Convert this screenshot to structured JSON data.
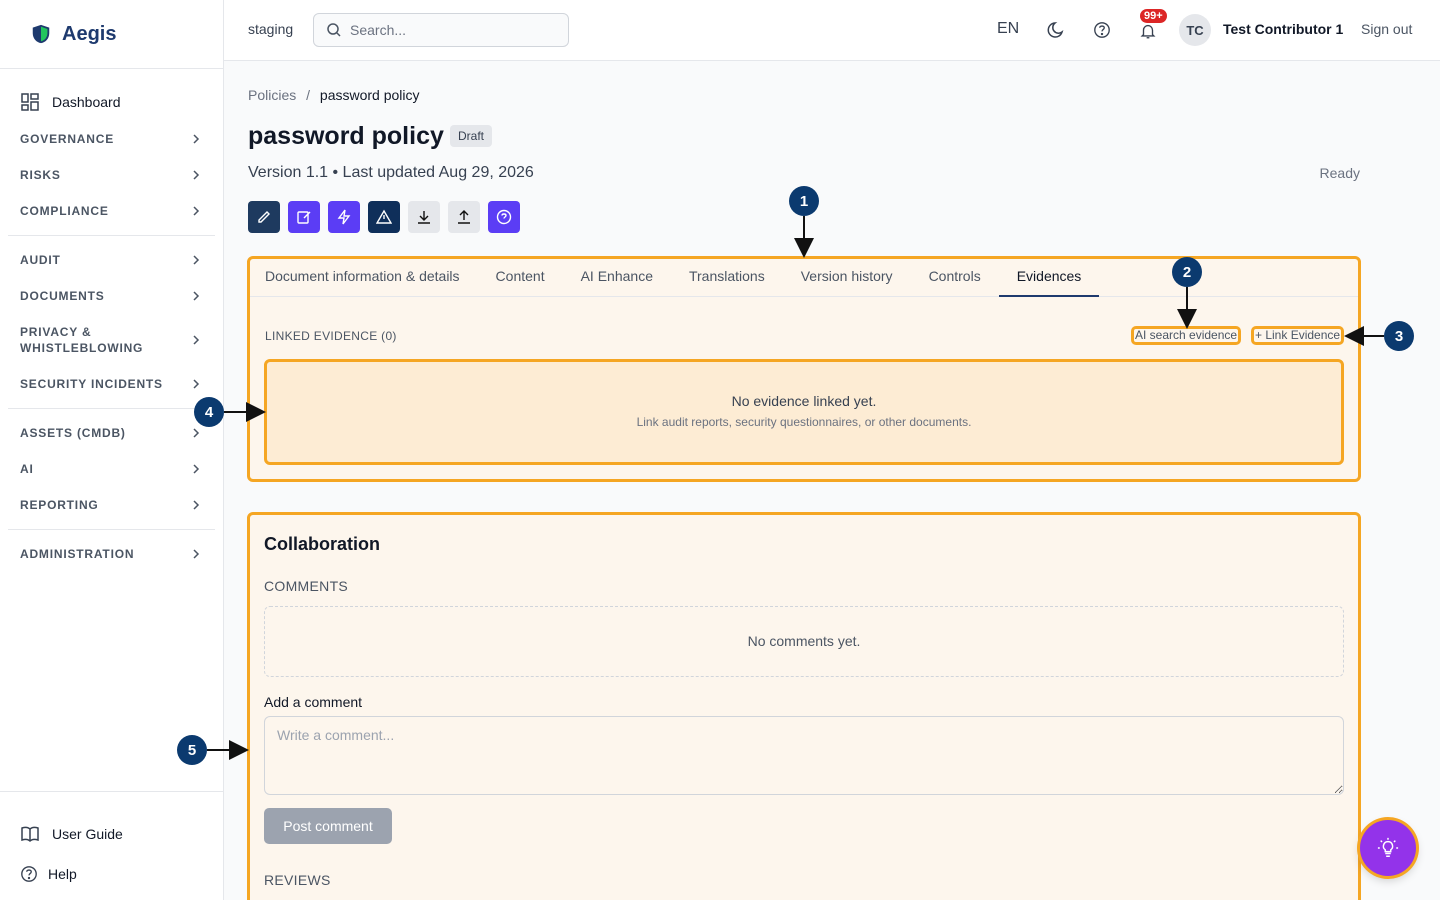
{
  "brand": {
    "name": "Aegis"
  },
  "sidebar": {
    "dashboard": "Dashboard",
    "groups": [
      [
        "Governance",
        "Risks",
        "Compliance"
      ],
      [
        "Audit",
        "Documents",
        "Privacy & Whistleblowing",
        "Security Incidents"
      ],
      [
        "Assets (CMDB)",
        "AI",
        "Reporting"
      ],
      [
        "Administration"
      ]
    ],
    "user_guide": "User Guide",
    "help": "Help"
  },
  "topbar": {
    "env": "staging",
    "search_placeholder": "Search...",
    "lang": "EN",
    "notif_count": "99+",
    "avatar": "TC",
    "user": "Test Contributor 1",
    "sign_out": "Sign out"
  },
  "page": {
    "breadcrumb_root": "Policies",
    "breadcrumb_sep": "/",
    "breadcrumb_current": "password policy",
    "title": "password policy",
    "status": "Draft",
    "meta": "Version 1.1 • Last updated Aug 29, 2026",
    "ready": "Ready"
  },
  "toolbar_icons": [
    {
      "name": "edit-icon",
      "bg": "#1e3a5f"
    },
    {
      "name": "edit-document-icon",
      "bg": "#5b3df5"
    },
    {
      "name": "lightning-icon",
      "bg": "#5b3df5"
    },
    {
      "name": "warning-icon",
      "bg": "#0f2f5a"
    },
    {
      "name": "download-icon",
      "bg": "#e5e7eb"
    },
    {
      "name": "upload-icon",
      "bg": "#e5e7eb"
    },
    {
      "name": "help-circle-icon",
      "bg": "#5b3df5"
    }
  ],
  "tabs": [
    "Document information & details",
    "Content",
    "AI Enhance",
    "Translations",
    "Version history",
    "Controls",
    "Evidences"
  ],
  "active_tab": "Evidences",
  "evidence": {
    "header": "LINKED EVIDENCE (0)",
    "ai_search": "AI search evidence",
    "link": "+ Link Evidence",
    "empty_title": "No evidence linked yet.",
    "empty_sub": "Link audit reports, security questionnaires, or other documents."
  },
  "collab": {
    "title": "Collaboration",
    "comments_label": "COMMENTS",
    "no_comments": "No comments yet.",
    "add_label": "Add a comment",
    "placeholder": "Write a comment...",
    "post": "Post comment",
    "reviews_label": "REVIEWS"
  },
  "markers": [
    "1",
    "2",
    "3",
    "4",
    "5"
  ],
  "colors": {
    "highlight": "#f5a623",
    "marker": "#0b3a6f",
    "brand": "#1e3a6e"
  }
}
